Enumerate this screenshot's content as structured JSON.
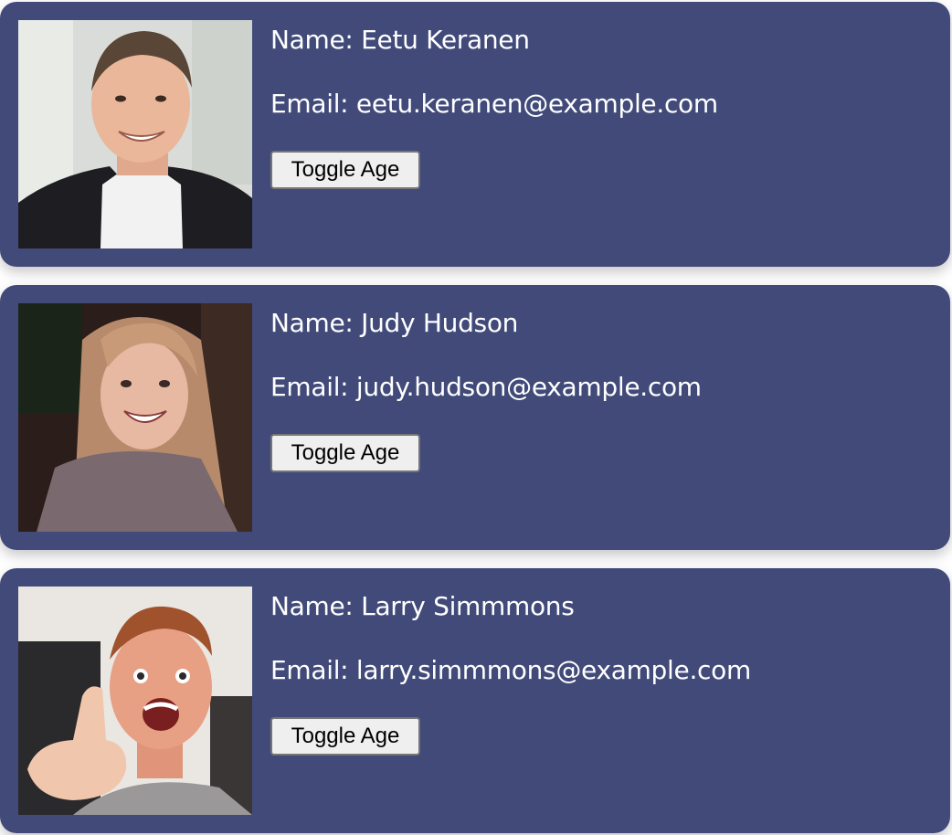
{
  "users": [
    {
      "name_line": "Name: Eetu Keranen",
      "email_line": "Email: eetu.keranen@example.com",
      "toggle_label": "Toggle Age"
    },
    {
      "name_line": "Name: Judy Hudson",
      "email_line": "Email: judy.hudson@example.com",
      "toggle_label": "Toggle Age"
    },
    {
      "name_line": "Name: Larry Simmmons",
      "email_line": "Email: larry.simmmons@example.com",
      "toggle_label": "Toggle Age"
    }
  ],
  "colors": {
    "card_background": "#414a79",
    "card_text": "#ffffff",
    "button_background": "#efefef",
    "button_border": "#767676"
  }
}
